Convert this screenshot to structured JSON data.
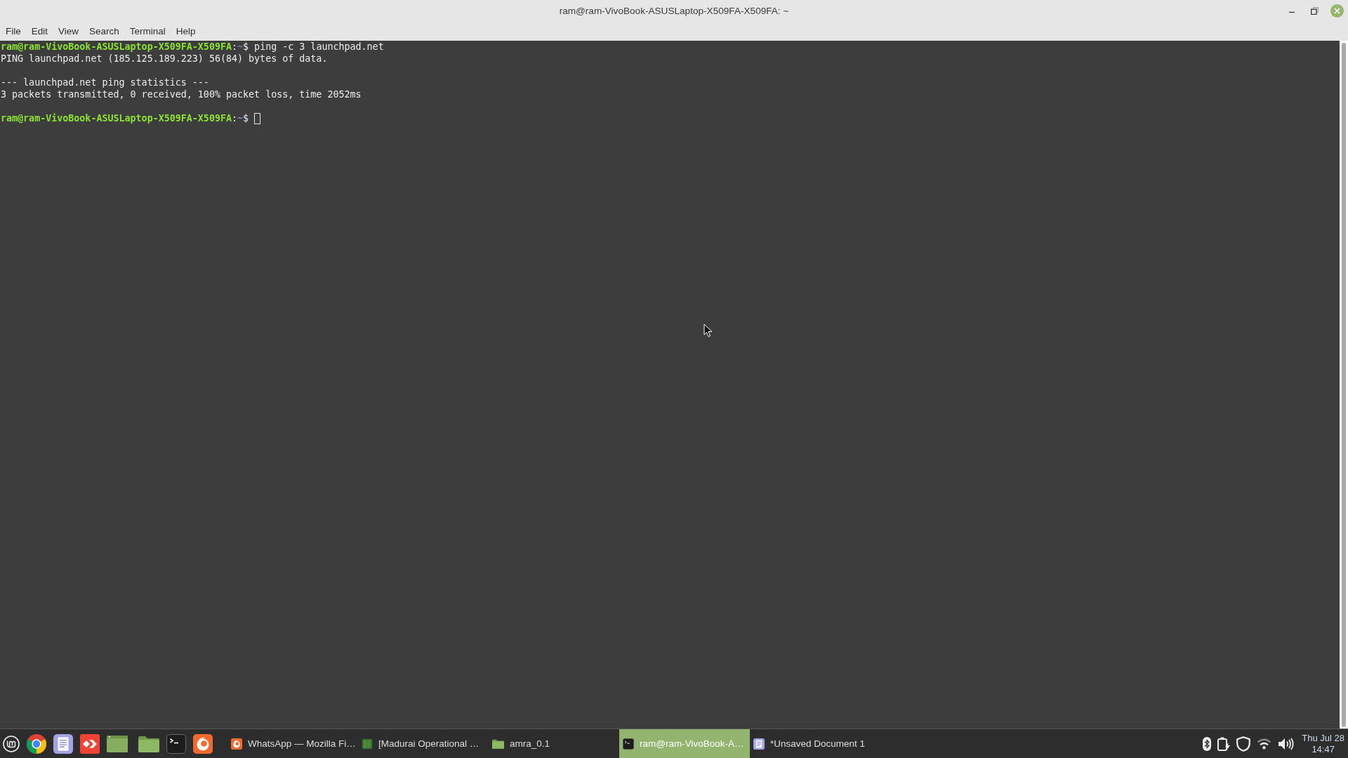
{
  "window": {
    "title": "ram@ram-VivoBook-ASUSLaptop-X509FA-X509FA: ~"
  },
  "menu": [
    "File",
    "Edit",
    "View",
    "Search",
    "Terminal",
    "Help"
  ],
  "terminal": {
    "lines": [
      {
        "kind": "prompt",
        "user_host": "ram@ram-VivoBook-ASUSLaptop-X509FA-X509FA",
        "separator": ":",
        "path": "~",
        "symbol": "$",
        "command": "ping -c 3 launchpad.net",
        "cursor": false
      },
      {
        "kind": "output",
        "text": "PING launchpad.net (185.125.189.223) 56(84) bytes of data."
      },
      {
        "kind": "blank"
      },
      {
        "kind": "output",
        "text": "--- launchpad.net ping statistics ---"
      },
      {
        "kind": "output",
        "text": "3 packets transmitted, 0 received, 100% packet loss, time 2052ms"
      },
      {
        "kind": "blank"
      },
      {
        "kind": "prompt",
        "user_host": "ram@ram-VivoBook-ASUSLaptop-X509FA-X509FA",
        "separator": ":",
        "path": "~",
        "symbol": "$",
        "cursor": true
      }
    ]
  },
  "taskbar": {
    "windows": [
      {
        "kind": "browser",
        "label": "WhatsApp — Mozilla Fi…",
        "selected": false
      },
      {
        "kind": "sheet",
        "label": "[Madurai Operational …",
        "selected": false
      },
      {
        "kind": "folder",
        "label": "amra_0.1",
        "selected": false
      },
      {
        "kind": "terminal",
        "label": "ram@ram-VivoBook-A…",
        "selected": true
      },
      {
        "kind": "document",
        "label": "*Unsaved Document 1",
        "selected": false
      }
    ],
    "clock": {
      "date": "Thu Jul 28",
      "time": "14:47"
    }
  }
}
